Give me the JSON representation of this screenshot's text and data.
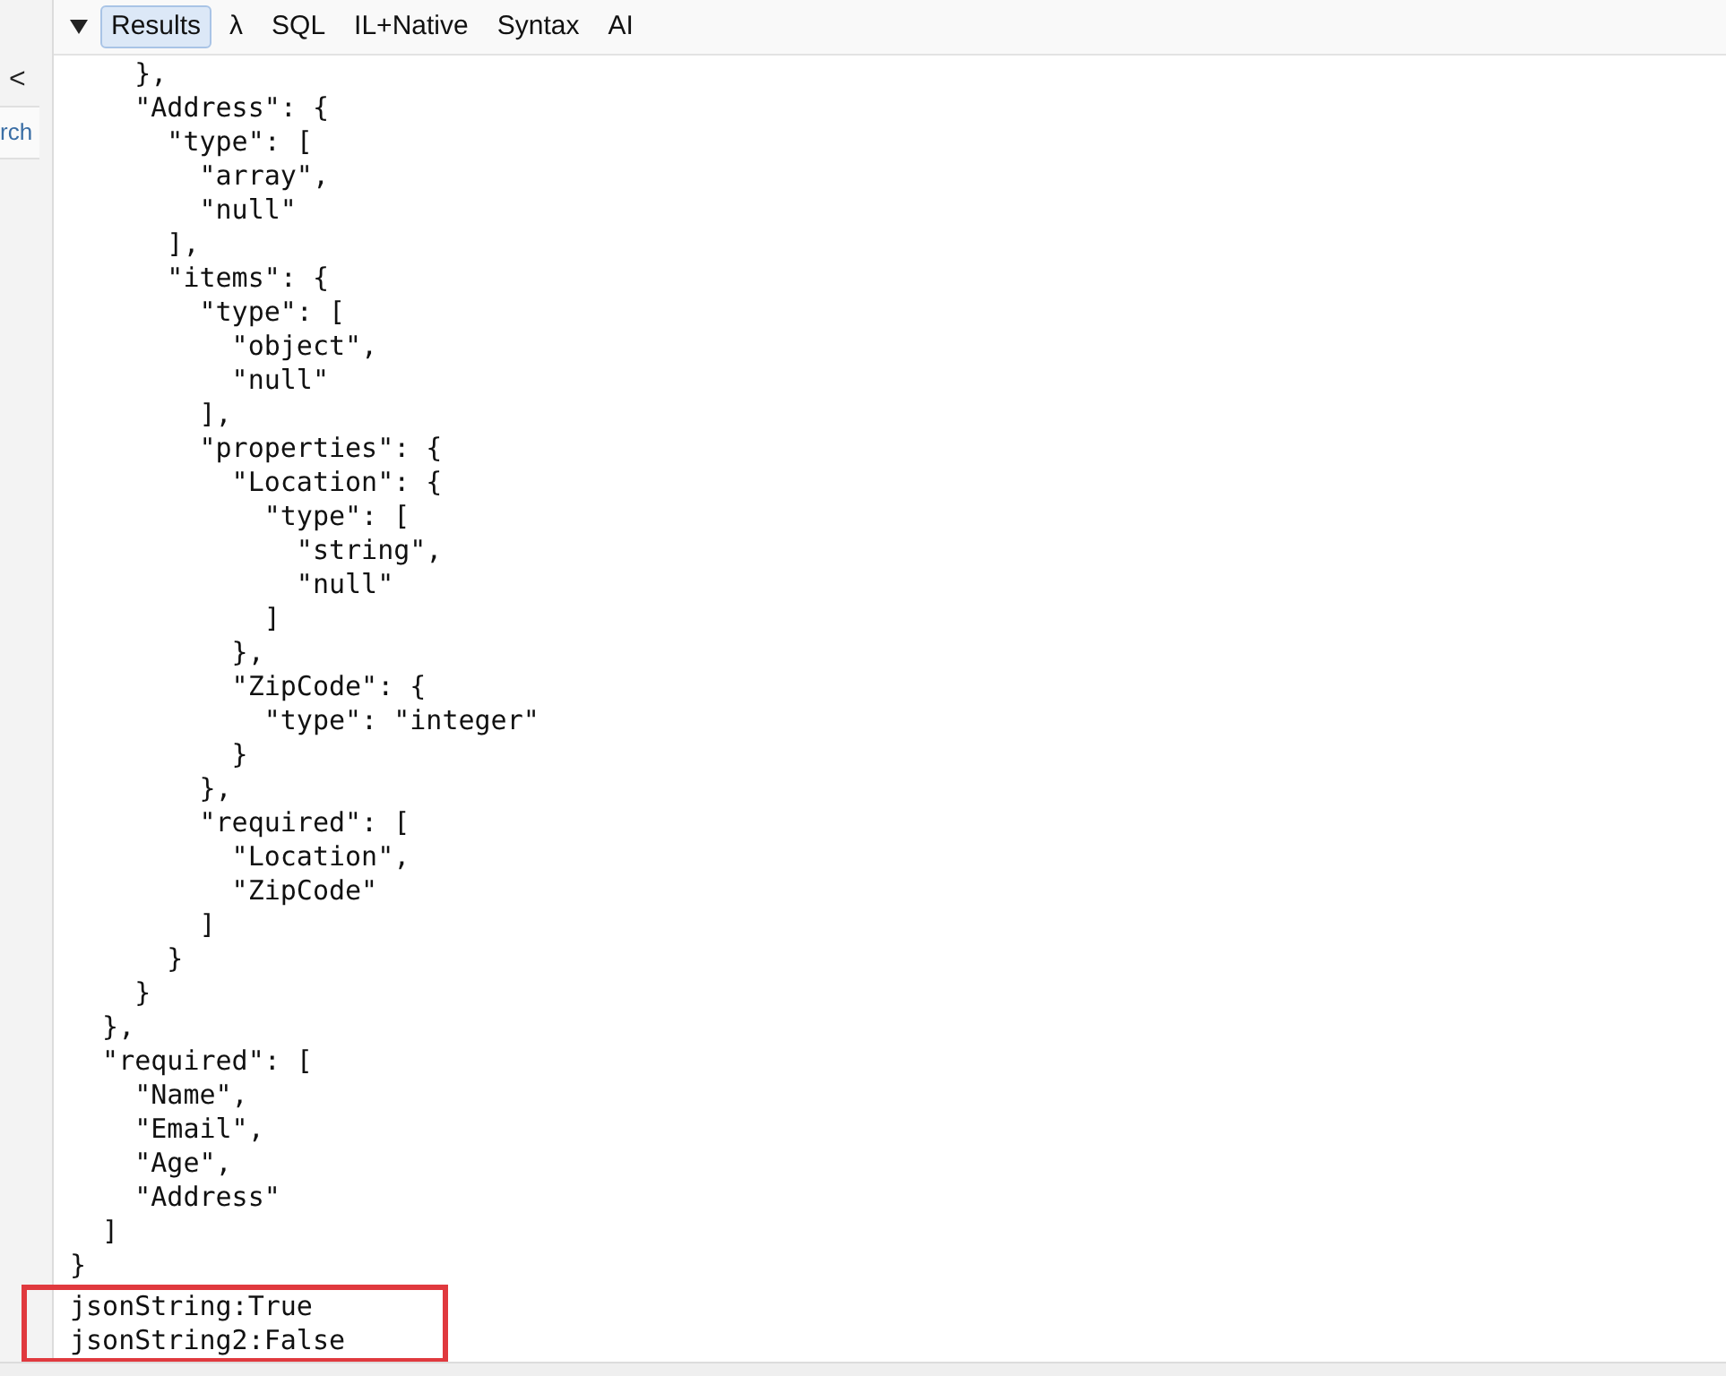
{
  "sidebar": {
    "collapse_glyph": "<",
    "search_tab": "rch"
  },
  "toolbar": {
    "tabs": [
      {
        "label": "Results",
        "selected": true
      },
      {
        "label": "λ",
        "selected": false
      },
      {
        "label": "SQL",
        "selected": false
      },
      {
        "label": "IL+Native",
        "selected": false
      },
      {
        "label": "Syntax",
        "selected": false
      },
      {
        "label": "AI",
        "selected": false
      }
    ]
  },
  "results": {
    "lines": [
      "    },",
      "    \"Address\": {",
      "      \"type\": [",
      "        \"array\",",
      "        \"null\"",
      "      ],",
      "      \"items\": {",
      "        \"type\": [",
      "          \"object\",",
      "          \"null\"",
      "        ],",
      "        \"properties\": {",
      "          \"Location\": {",
      "            \"type\": [",
      "              \"string\",",
      "              \"null\"",
      "            ]",
      "          },",
      "          \"ZipCode\": {",
      "            \"type\": \"integer\"",
      "          }",
      "        },",
      "        \"required\": [",
      "          \"Location\",",
      "          \"ZipCode\"",
      "        ]",
      "      }",
      "    }",
      "  },",
      "  \"required\": [",
      "    \"Name\",",
      "    \"Email\",",
      "    \"Age\",",
      "    \"Address\"",
      "  ]",
      "}"
    ],
    "output_lines": [
      "jsonString:True",
      "jsonString2:False"
    ]
  }
}
